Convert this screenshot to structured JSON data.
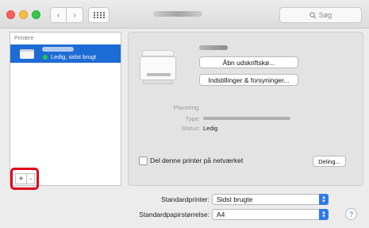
{
  "toolbar": {
    "search_placeholder": "Søg",
    "back_icon": "chevron-left-icon",
    "forward_icon": "chevron-right-icon",
    "grid_icon": "grid-icon"
  },
  "sidebar": {
    "header": "Printere",
    "printers": [
      {
        "status": "Ledig, sidst brugt"
      }
    ],
    "add_label": "+",
    "remove_label": "-"
  },
  "detail": {
    "open_queue_label": "Åbn udskriftskø...",
    "settings_label": "Indstillinger & forsyninger...",
    "location_label": "Placering:",
    "type_label": "Type:",
    "status_label": "Status:",
    "status_value": "Ledig",
    "share_label": "Del denne printer på netværket",
    "share_button": "Deling..."
  },
  "defaults": {
    "printer_label": "Standardprinter:",
    "printer_value": "Sidst brugte",
    "paper_label": "Standardpapirstørrelse:",
    "paper_value": "A4",
    "help_label": "?"
  },
  "colors": {
    "selection": "#1d6bd5",
    "highlight_box": "#e0001a",
    "status_dot": "#29c74a"
  }
}
